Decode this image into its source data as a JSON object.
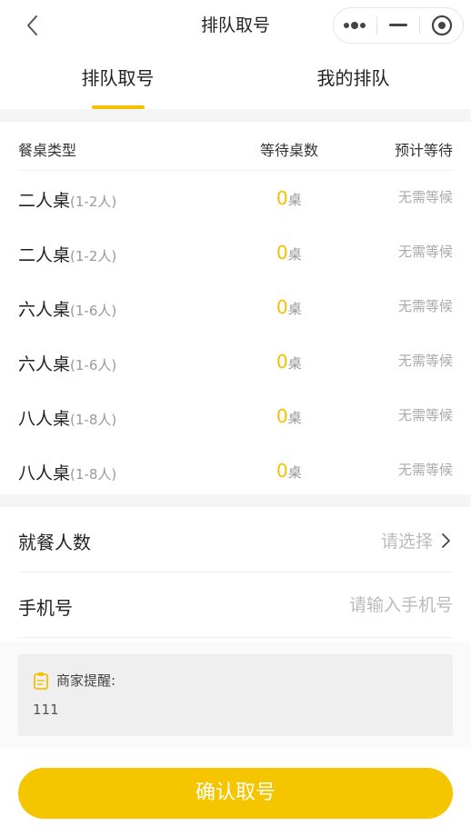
{
  "nav": {
    "title": "排队取号",
    "back_icon": "chevron-left-icon",
    "more_icon": "more-dots-icon",
    "minimize_icon": "minus-icon",
    "close_icon": "target-circle-icon"
  },
  "tabs": [
    {
      "label": "排队取号",
      "active": true
    },
    {
      "label": "我的排队",
      "active": false
    }
  ],
  "table": {
    "headers": {
      "type": "餐桌类型",
      "waiting": "等待桌数",
      "estimate": "预计等待"
    },
    "unit": "桌",
    "rows": [
      {
        "name": "二人桌",
        "capacity": "(1-2人)",
        "count": "0",
        "estimate": "无需等候"
      },
      {
        "name": "二人桌",
        "capacity": "(1-2人)",
        "count": "0",
        "estimate": "无需等候"
      },
      {
        "name": "六人桌",
        "capacity": "(1-6人)",
        "count": "0",
        "estimate": "无需等候"
      },
      {
        "name": "六人桌",
        "capacity": "(1-6人)",
        "count": "0",
        "estimate": "无需等候"
      },
      {
        "name": "八人桌",
        "capacity": "(1-8人)",
        "count": "0",
        "estimate": "无需等候"
      },
      {
        "name": "八人桌",
        "capacity": "(1-8人)",
        "count": "0",
        "estimate": "无需等候"
      }
    ]
  },
  "form": {
    "party_size": {
      "label": "就餐人数",
      "value": "请选择"
    },
    "phone": {
      "label": "手机号",
      "placeholder": "请输入手机号",
      "value": ""
    }
  },
  "notice": {
    "title": "商家提醒:",
    "text": "111",
    "icon": "clipboard-icon"
  },
  "confirm_label": "确认取号",
  "colors": {
    "accent": "#f5c000",
    "button": "#f5c500"
  }
}
